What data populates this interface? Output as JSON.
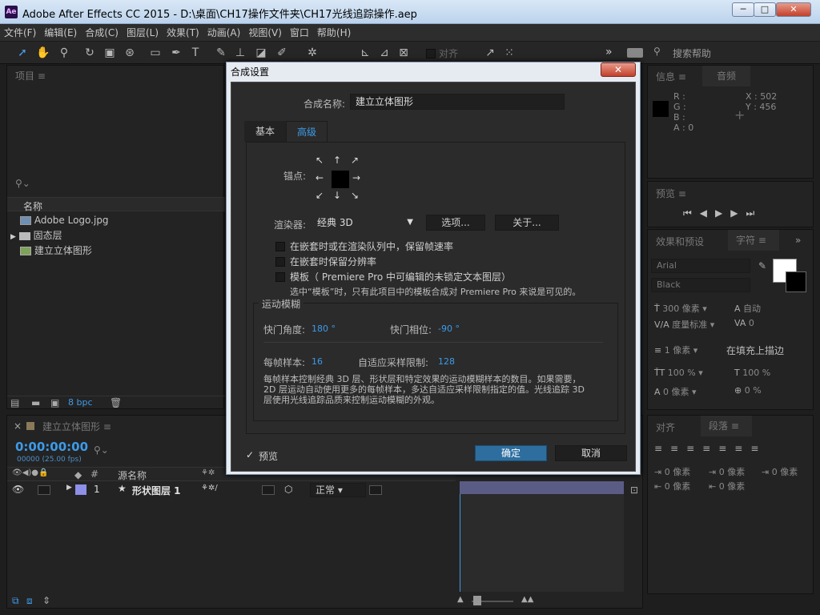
{
  "window": {
    "title": "Adobe After Effects CC 2015 - D:\\桌面\\CH17操作文件夹\\CH17光线追踪操作.aep",
    "app_icon": "Ae",
    "minimize": "─",
    "maximize": "□",
    "close": "✕"
  },
  "menu": [
    "文件(F)",
    "编辑(E)",
    "合成(C)",
    "图层(L)",
    "效果(T)",
    "动画(A)",
    "视图(V)",
    "窗口",
    "帮助(H)"
  ],
  "toolbar": {
    "snap_label": "对齐",
    "search_help": "搜索帮助",
    "more": "»"
  },
  "project_panel": {
    "title": "项目",
    "menu": "≡",
    "col_name": "名称",
    "items": [
      {
        "name": "Adobe Logo.jpg",
        "type": "image"
      },
      {
        "name": "固态层",
        "type": "folder"
      },
      {
        "name": "建立立体图形",
        "type": "comp"
      }
    ],
    "bpc": "8 bpc"
  },
  "info_panel": {
    "tab_info": "信息",
    "tab_audio": "音频",
    "r": "R :",
    "g": "G :",
    "b": "B :",
    "a": "A : 0",
    "x": "X : 502",
    "y": "Y : 456"
  },
  "preview_panel": {
    "title": "预览"
  },
  "effects_panel": {
    "title": "效果和预设"
  },
  "char_panel": {
    "title": "字符",
    "font": "Arial",
    "style": "Black",
    "size": "300 像素",
    "leading": "自动",
    "kerning": "度量标准",
    "tracking": "0",
    "stroke": "1 像素",
    "stroke_mode": "在填充上描边",
    "vscale": "100 %",
    "hscale": "100 %",
    "baseline": "0 像素",
    "tsume": "0 %"
  },
  "align_panel": {
    "tab_align": "对齐",
    "tab_para": "段落",
    "indent1": "0 像素",
    "indent2": "0 像素",
    "indent3": "0 像素",
    "space1": "0 像素",
    "space2": "0 像素"
  },
  "timeline": {
    "comp_tab": "建立立体图形",
    "timecode": "0:00:00:00",
    "frames": "00000 (25.00 fps)",
    "col_hash": "#",
    "col_source": "源名称",
    "layer_num": "1",
    "layer_name": "形状图层 1",
    "mode": "正常"
  },
  "dialog": {
    "title": "合成设置",
    "close": "✕",
    "comp_name_label": "合成名称:",
    "comp_name": "建立立体图形",
    "tab_basic": "基本",
    "tab_advanced": "高级",
    "anchor_label": "锚点:",
    "renderer_label": "渲染器:",
    "renderer_value": "经典 3D",
    "options_btn": "选项...",
    "about_btn": "关于...",
    "chk1": "在嵌套时或在渲染队列中，保留帧速率",
    "chk2": "在嵌套时保留分辨率",
    "chk3": "模板（ Premiere Pro 中可编辑的未锁定文本图层）",
    "chk3_hint": "选中“模板”时，只有此项目中的模板合成对 Premiere Pro 来说是可见的。",
    "motion_blur_title": "运动模糊",
    "shutter_angle_label": "快门角度:",
    "shutter_angle": "180 °",
    "shutter_phase_label": "快门相位:",
    "shutter_phase": "-90 °",
    "samples_label": "每帧样本:",
    "samples": "16",
    "adaptive_label": "自适应采样限制:",
    "adaptive": "128",
    "description": "每帧样本控制经典 3D 层、形状层和特定效果的运动模糊样本的数目。如果需要，2D 层运动自动使用更多的每帧样本，多达自适应采样限制指定的值。光线追踪 3D 层使用光线追踪品质来控制运动模糊的外观。",
    "preview_label": "预览",
    "ok": "确定",
    "cancel": "取消"
  },
  "colors": {
    "accent": "#3d9be9",
    "ok_button": "#2d6e9f",
    "panel": "#232323"
  }
}
